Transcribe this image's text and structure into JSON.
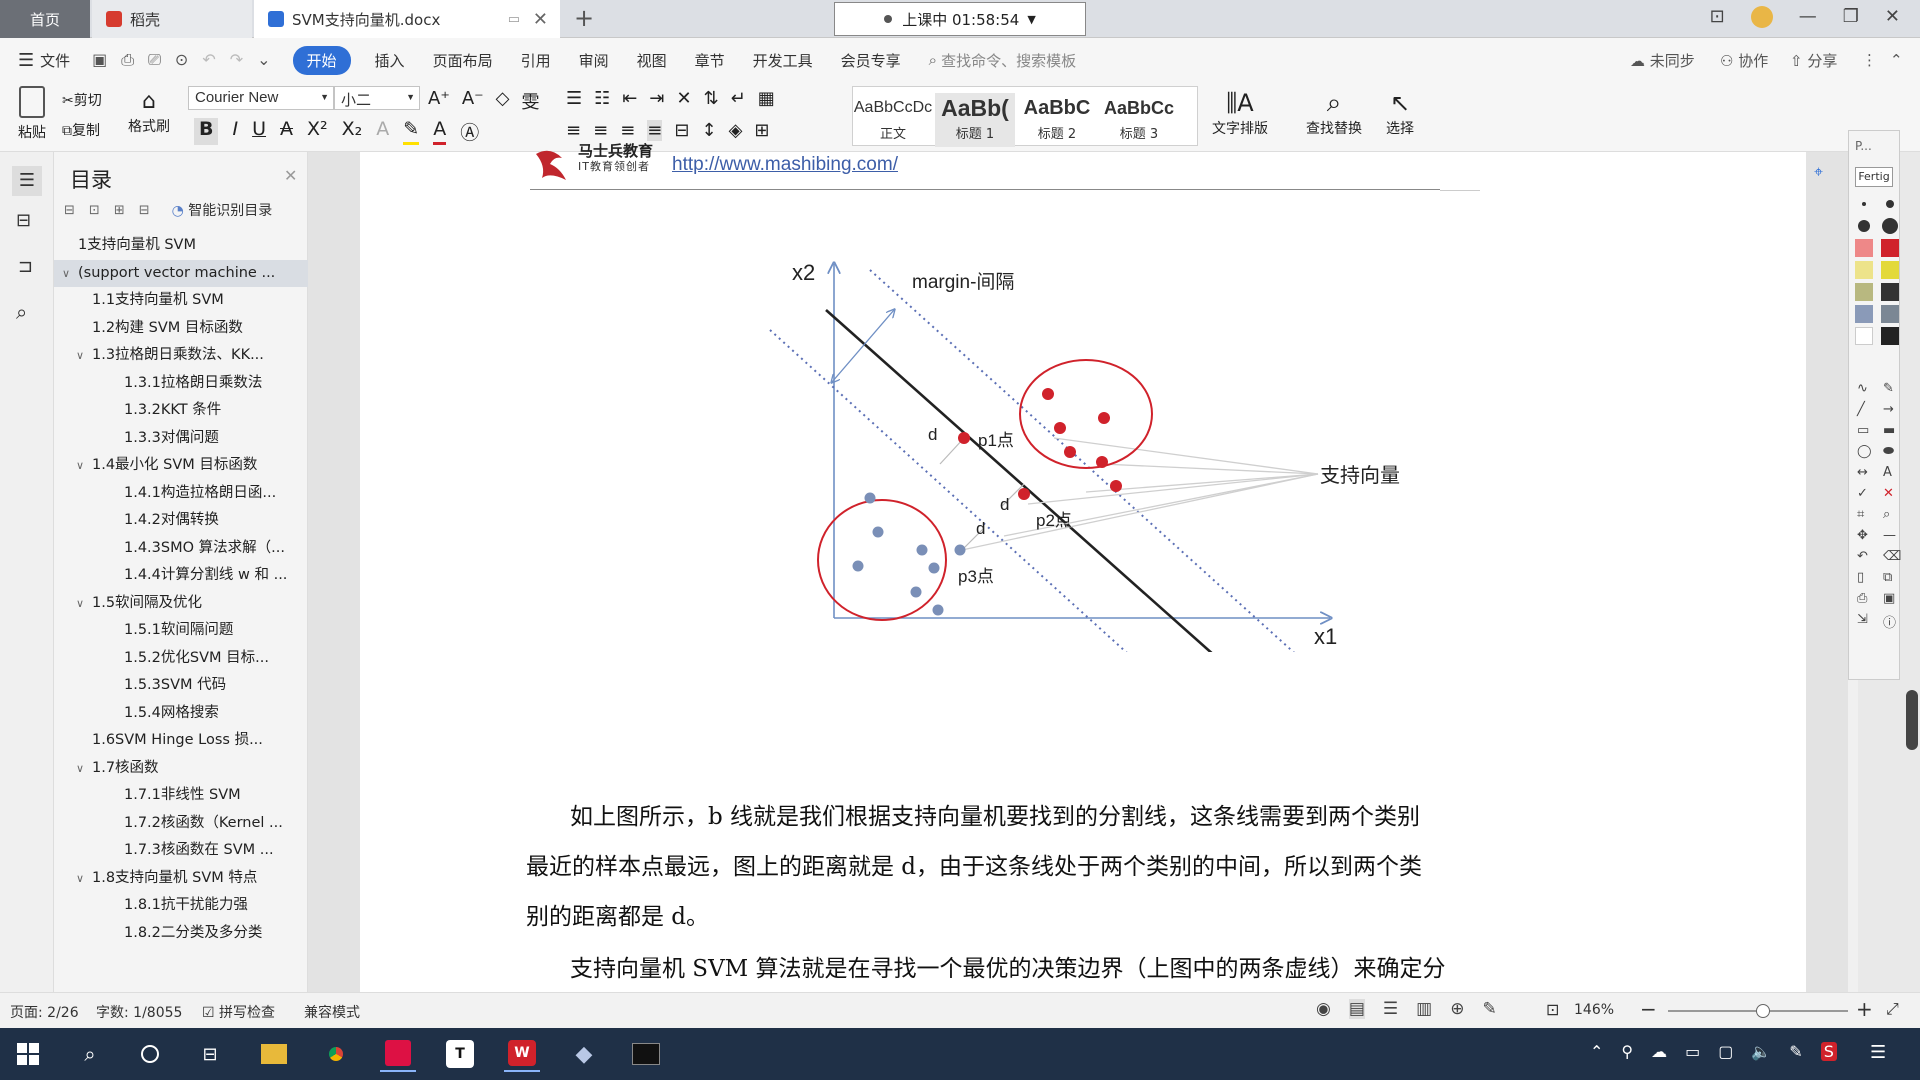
{
  "tabs": {
    "home": "首页",
    "daoke": "稻壳",
    "doc": "SVM支持向量机.docx"
  },
  "clock": "上课中 01:58:54",
  "menu": {
    "file": "文件",
    "items": [
      "开始",
      "插入",
      "页面布局",
      "引用",
      "审阅",
      "视图",
      "章节",
      "开发工具",
      "会员专享"
    ],
    "search_placeholder": "查找命令、搜索模板",
    "sync": "未同步",
    "collab": "协作",
    "share": "分享"
  },
  "ribbon": {
    "paste": "粘贴",
    "cut": "剪切",
    "copy": "复制",
    "format_painter": "格式刷",
    "font": "Courier New",
    "size": "小二",
    "styles": [
      {
        "preview": "AaBbCcDc",
        "name": "正文"
      },
      {
        "preview": "AaBb(",
        "name": "标题 1"
      },
      {
        "preview": "AaBbC",
        "name": "标题 2"
      },
      {
        "preview": "AaBbCc",
        "name": "标题 3"
      }
    ],
    "text_layout": "文字排版",
    "find_replace": "查找替换",
    "select": "选择"
  },
  "nav": {
    "title": "目录",
    "smart": "智能识别目录",
    "toc": [
      {
        "level": 0,
        "text": "1支持向量机 SVM",
        "expand": ""
      },
      {
        "level": 0,
        "text": "(support vector machine ...",
        "expand": "v",
        "selected": true
      },
      {
        "level": 1,
        "text": "1.1支持向量机 SVM",
        "expand": ""
      },
      {
        "level": 1,
        "text": "1.2构建 SVM 目标函数",
        "expand": ""
      },
      {
        "level": 1,
        "text": "1.3拉格朗日乘数法、KK...",
        "expand": "v"
      },
      {
        "level": 2,
        "text": "1.3.1拉格朗日乘数法",
        "expand": ""
      },
      {
        "level": 2,
        "text": "1.3.2KKT 条件",
        "expand": ""
      },
      {
        "level": 2,
        "text": "1.3.3对偶问题",
        "expand": ""
      },
      {
        "level": 1,
        "text": "1.4最小化 SVM 目标函数",
        "expand": "v"
      },
      {
        "level": 2,
        "text": "1.4.1构造拉格朗日函...",
        "expand": ""
      },
      {
        "level": 2,
        "text": "1.4.2对偶转换",
        "expand": ""
      },
      {
        "level": 2,
        "text": "1.4.3SMO 算法求解（...",
        "expand": ""
      },
      {
        "level": 2,
        "text": "1.4.4计算分割线 w 和 ...",
        "expand": ""
      },
      {
        "level": 1,
        "text": "1.5软间隔及优化",
        "expand": "v"
      },
      {
        "level": 2,
        "text": "1.5.1软间隔问题",
        "expand": ""
      },
      {
        "level": 2,
        "text": "1.5.2优化SVM 目标...",
        "expand": ""
      },
      {
        "level": 2,
        "text": "1.5.3SVM 代码",
        "expand": ""
      },
      {
        "level": 2,
        "text": "1.5.4网格搜索",
        "expand": ""
      },
      {
        "level": 1,
        "text": "1.6SVM Hinge Loss 损...",
        "expand": ""
      },
      {
        "level": 1,
        "text": "1.7核函数",
        "expand": "v"
      },
      {
        "level": 2,
        "text": "1.7.1非线性 SVM",
        "expand": ""
      },
      {
        "level": 2,
        "text": "1.7.2核函数（Kernel ...",
        "expand": ""
      },
      {
        "level": 2,
        "text": "1.7.3核函数在 SVM ...",
        "expand": ""
      },
      {
        "level": 1,
        "text": "1.8支持向量机 SVM 特点",
        "expand": "v"
      },
      {
        "level": 2,
        "text": "1.8.1抗干扰能力强",
        "expand": ""
      },
      {
        "level": 2,
        "text": "1.8.2二分类及多分类",
        "expand": ""
      }
    ]
  },
  "header": {
    "brand": "马士兵教育",
    "slogan": "IT教育领创者",
    "url": "http://www.mashibing.com/"
  },
  "figure": {
    "x2": "x2",
    "x1": "x1",
    "margin": "margin-间隔",
    "p1": "p1点",
    "p2": "p2点",
    "p3": "p3点",
    "d": "d",
    "sv": "支持向量",
    "bline": "b线"
  },
  "body": {
    "para1_lines": [
      "如上图所示，b 线就是我们根据支持向量机要找到的分割线，这条线需要到两个类别",
      "最近的样本点最远，图上的距离就是 d，由于这条线处于两个类别的中间，所以到两个类",
      "别的距离都是 d。"
    ],
    "para2": "支持向量机 SVM 算法就是在寻找一个最优的决策边界（上图中的两条虚线）来确定分"
  },
  "rightpanel": {
    "top": "P...",
    "btn": "Fertig"
  },
  "status": {
    "page": "页面: 2/26",
    "words": "字数: 1/8055",
    "spell": "拼写检查",
    "compat": "兼容模式",
    "zoom": "146%"
  },
  "colors": {
    "accent": "#2f6fd6",
    "red": "#d0222b",
    "blue": "#7a8fb7",
    "taskbar": "#1f3047"
  }
}
